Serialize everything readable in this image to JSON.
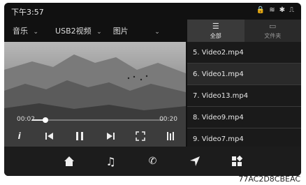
{
  "status": {
    "time": "下午3:57",
    "icons": [
      "lock-icon",
      "wifi-icon",
      "bluetooth-icon",
      "usb-icon"
    ]
  },
  "source_bar": {
    "items": [
      "音乐",
      "USB2视频",
      "图片"
    ]
  },
  "player": {
    "current_time": "00:02",
    "total_time": "00:20",
    "progress": 0.1
  },
  "tabs": {
    "all": "全部",
    "folder": "文件夹"
  },
  "playlist": [
    "5. Video2.mp4",
    "6. Video1.mp4",
    "7. Video13.mp4",
    "8. Video9.mp4",
    "9. Video7.mp4"
  ],
  "watermark": "77AC2D8CBEAC"
}
